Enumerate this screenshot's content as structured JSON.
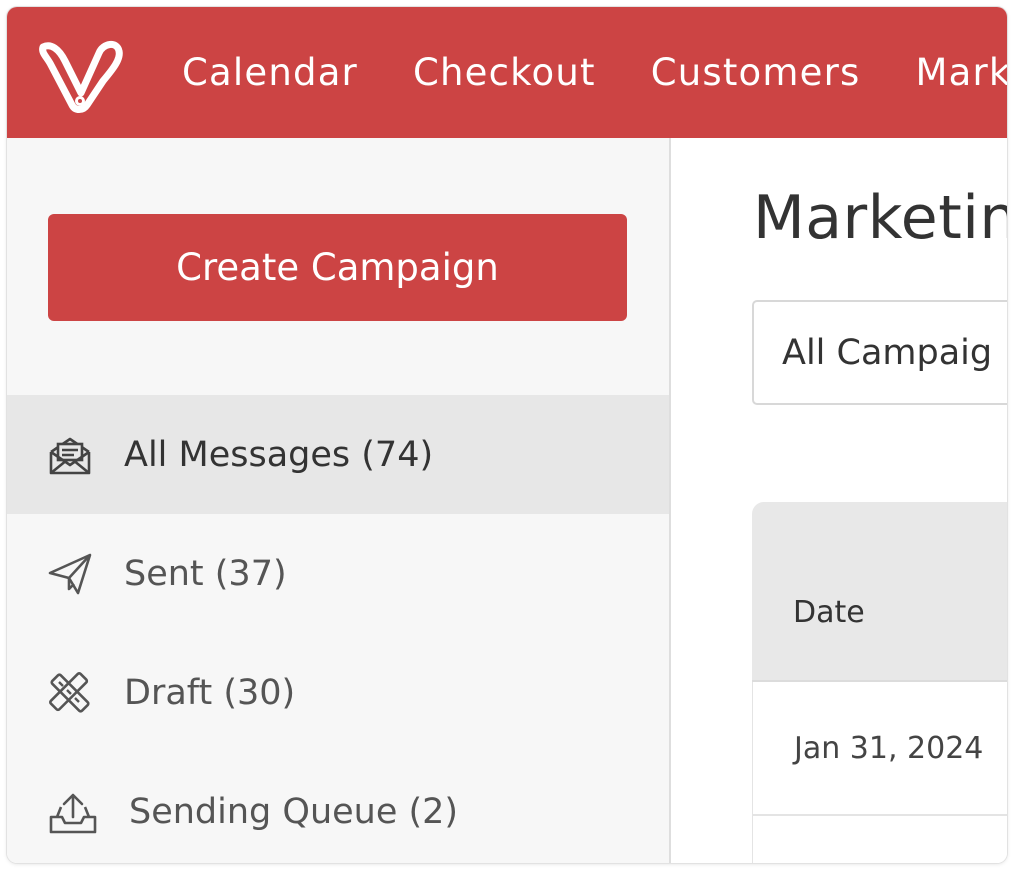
{
  "nav": {
    "logo_icon": "vagaro-v-logo",
    "items": [
      "Calendar",
      "Checkout",
      "Customers",
      "Marke"
    ]
  },
  "sidebar": {
    "create_button": "Create Campaign",
    "items": [
      {
        "label": "All Messages (74)",
        "icon": "open-envelope-icon",
        "active": true
      },
      {
        "label": "Sent (37)",
        "icon": "paper-plane-icon",
        "active": false
      },
      {
        "label": "Draft (30)",
        "icon": "pencil-ruler-icon",
        "active": false
      },
      {
        "label": "Sending Queue (2)",
        "icon": "tray-upload-icon",
        "active": false
      }
    ]
  },
  "main": {
    "title": "Marketin",
    "filter_value": "All Campaig",
    "table": {
      "columns": [
        "Date"
      ],
      "rows": [
        [
          "Jan 31, 2024"
        ]
      ]
    }
  },
  "colors": {
    "brand": "#cc4444",
    "sidebar_bg": "#f7f7f7",
    "active_item_bg": "#e7e7e7"
  }
}
